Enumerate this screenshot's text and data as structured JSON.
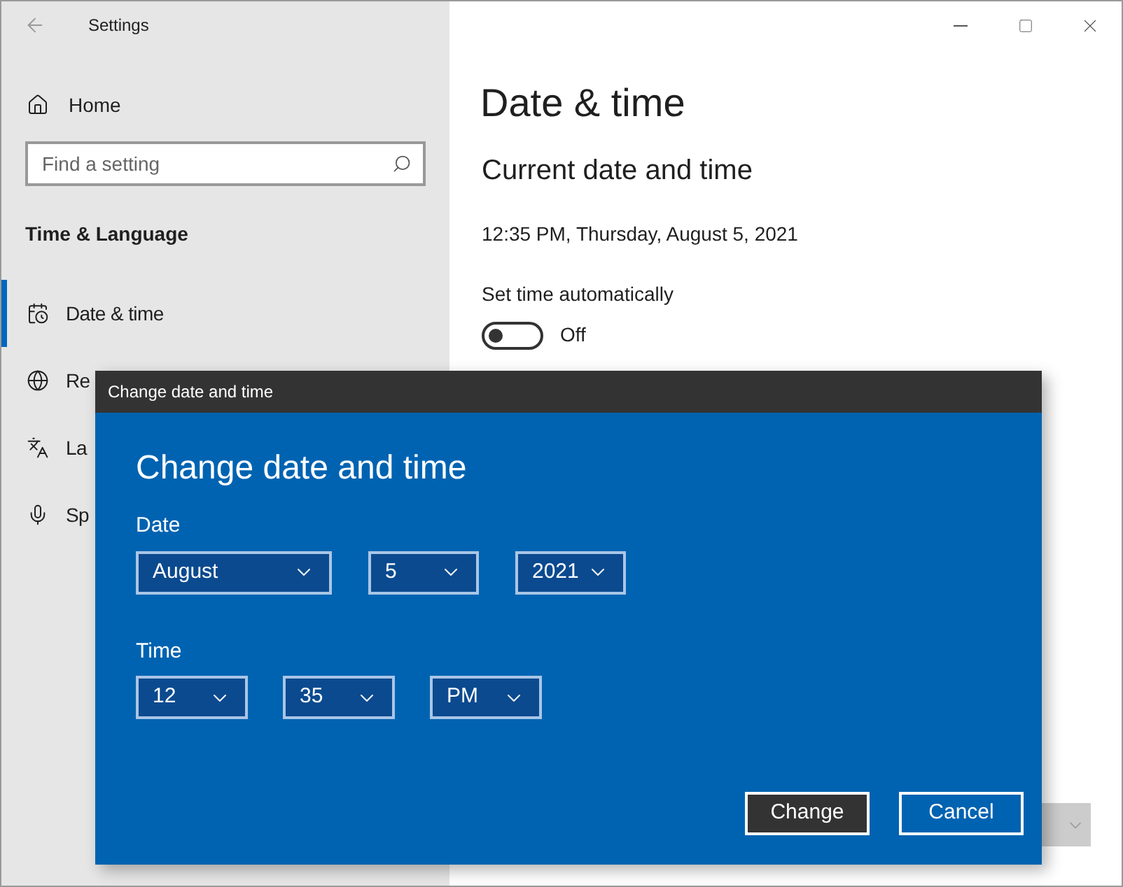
{
  "window": {
    "title": "Settings"
  },
  "sidebar": {
    "home": "Home",
    "search": {
      "placeholder": "Find a setting"
    },
    "section": "Time & Language",
    "items": [
      {
        "label": "Date & time",
        "selected": true
      },
      {
        "label": "Re",
        "selected": false
      },
      {
        "label": "La",
        "selected": false
      },
      {
        "label": "Sp",
        "selected": false
      }
    ]
  },
  "main": {
    "title": "Date & time",
    "subtitle": "Current date and time",
    "current": "12:35 PM, Thursday, August 5, 2021",
    "auto_label": "Set time automatically",
    "auto_toggle": {
      "on": false,
      "state_text": "Off"
    }
  },
  "dialog": {
    "title_bar": "Change date and time",
    "heading": "Change date and time",
    "date_label": "Date",
    "date_fields": [
      {
        "value": "August"
      },
      {
        "value": "5"
      },
      {
        "value": "2021"
      }
    ],
    "time_label": "Time",
    "time_fields": [
      {
        "value": "12"
      },
      {
        "value": "35"
      },
      {
        "value": "PM"
      }
    ],
    "buttons": [
      {
        "label": "Change",
        "selected": true
      },
      {
        "label": "Cancel",
        "selected": false
      }
    ]
  }
}
